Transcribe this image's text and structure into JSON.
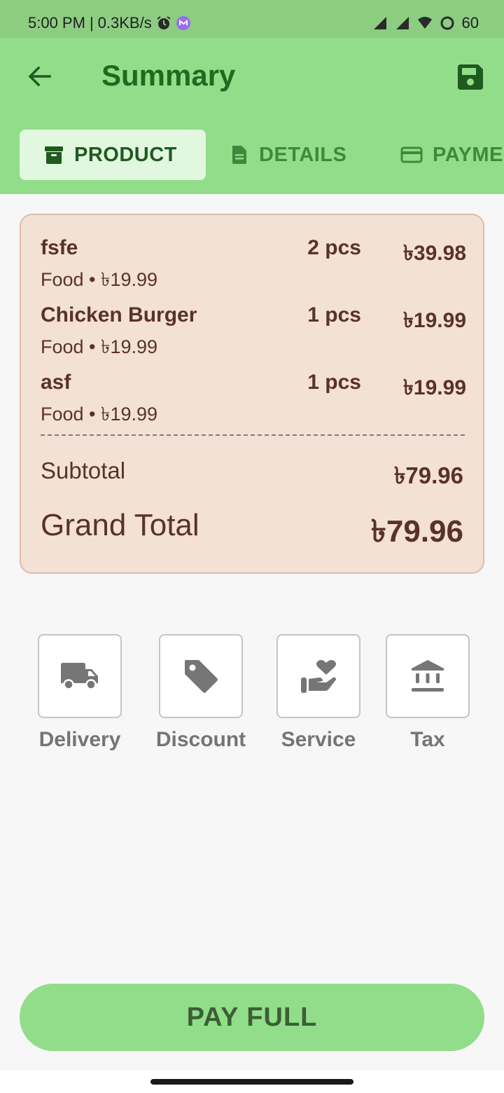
{
  "status_bar": {
    "time": "5:00 PM",
    "speed": "0.3KB/s",
    "battery": "60"
  },
  "app_bar": {
    "title": "Summary",
    "icons": {
      "back": "arrow-left-icon",
      "save": "floppy-disk-icon"
    }
  },
  "tabs": [
    {
      "label": "PRODUCT",
      "icon": "archive-box-icon",
      "active": true
    },
    {
      "label": "DETAILS",
      "icon": "document-icon",
      "active": false
    },
    {
      "label": "PAYMENT",
      "icon": "credit-card-icon",
      "active": false
    }
  ],
  "summary": {
    "items": [
      {
        "name": "fsfe",
        "meta": "Food • ৳19.99",
        "qty": "2 pcs",
        "price": "৳39.98"
      },
      {
        "name": "Chicken Burger",
        "meta": "Food • ৳19.99",
        "qty": "1 pcs",
        "price": "৳19.99"
      },
      {
        "name": "asf",
        "meta": "Food • ৳19.99",
        "qty": "1 pcs",
        "price": "৳19.99"
      }
    ],
    "subtotal_label": "Subtotal",
    "subtotal_value": "৳79.96",
    "grand_total_label": "Grand Total",
    "grand_total_value": "৳79.96"
  },
  "options": [
    {
      "label": "Delivery",
      "icon": "truck-icon"
    },
    {
      "label": "Discount",
      "icon": "tag-icon"
    },
    {
      "label": "Service",
      "icon": "hand-heart-icon"
    },
    {
      "label": "Tax",
      "icon": "bank-icon"
    }
  ],
  "pay_button": {
    "label": "PAY FULL"
  },
  "colors": {
    "app_bar": "#92dd89",
    "status_bar": "#8ccd82",
    "title": "#1f6a1f",
    "card_bg": "#f3e1d6",
    "card_text": "#5a3228"
  }
}
